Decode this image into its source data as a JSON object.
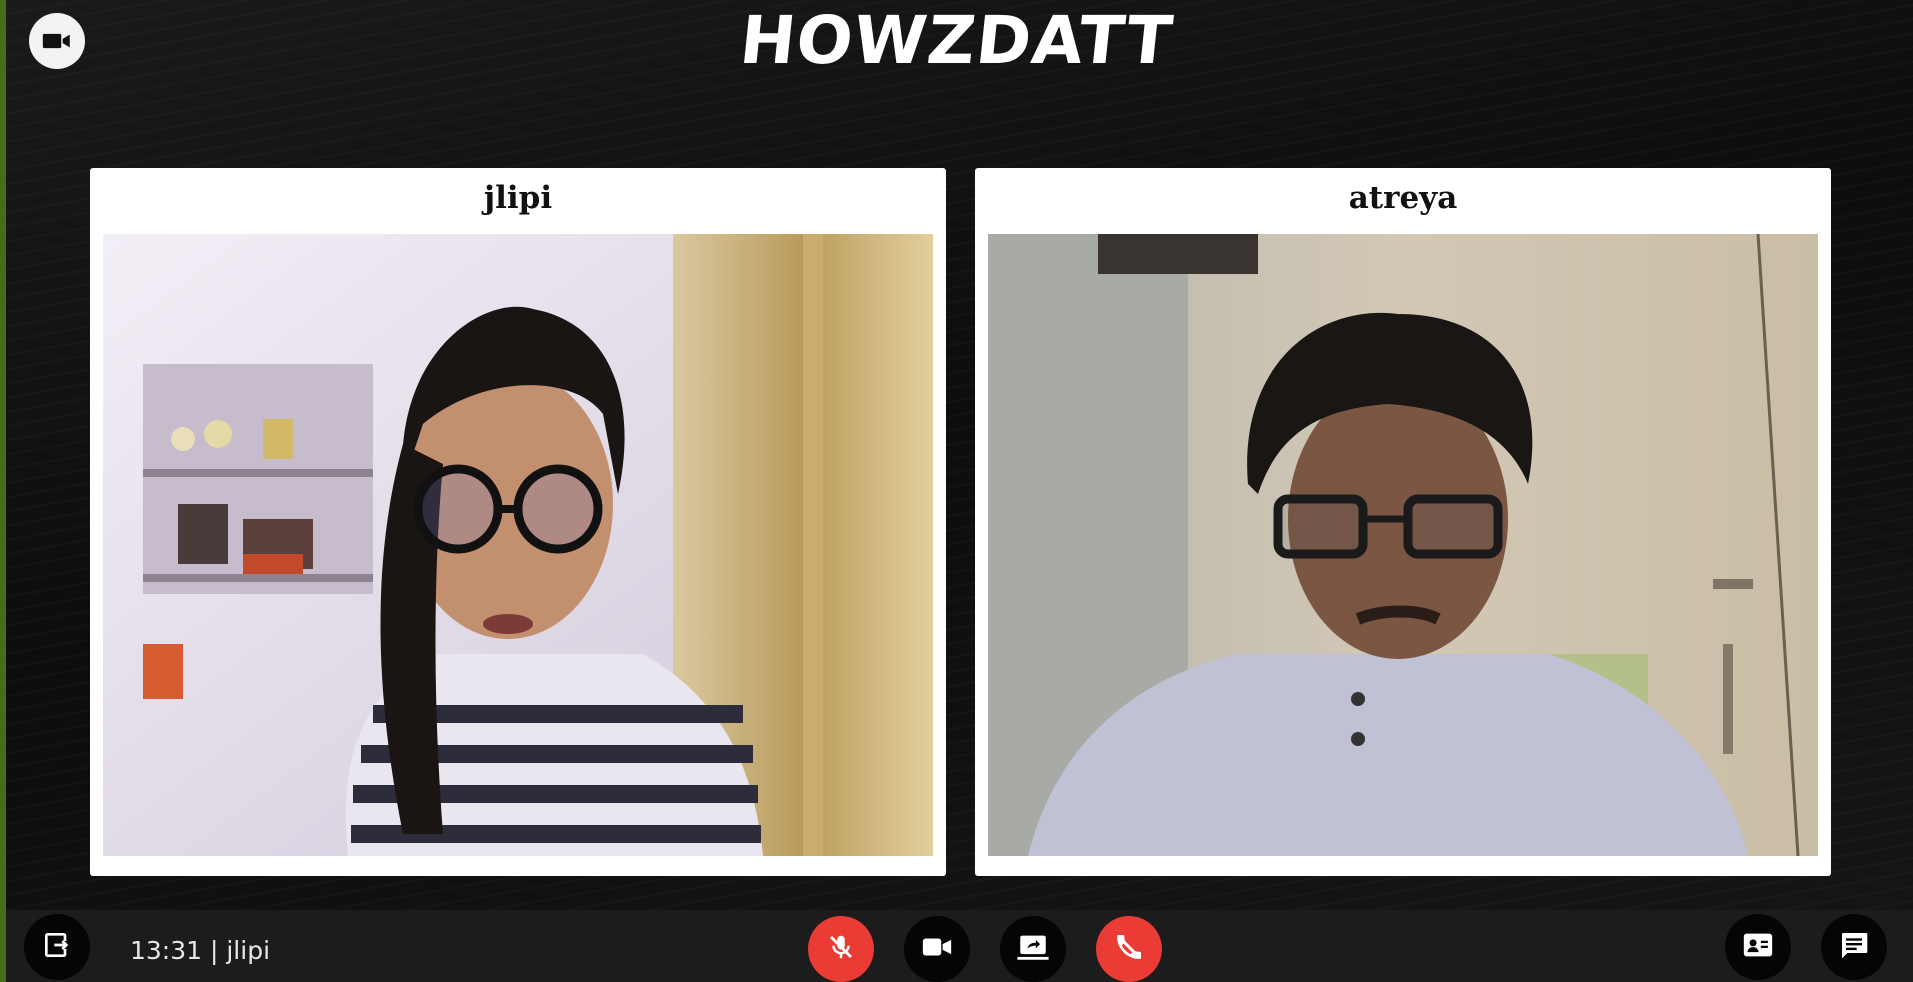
{
  "app": {
    "title": "HOWZDATT"
  },
  "participants": [
    {
      "name": "jlipi"
    },
    {
      "name": "atreya"
    }
  ],
  "toolbar": {
    "meeting_info": "13:31 | jlipi",
    "leave_icon": "exit-icon",
    "mic_state": "muted",
    "end_call_color": "#ea3b35"
  },
  "colors": {
    "background": "#111111",
    "accent_red": "#ea3b35",
    "edge_green": "#4a6b1e"
  }
}
